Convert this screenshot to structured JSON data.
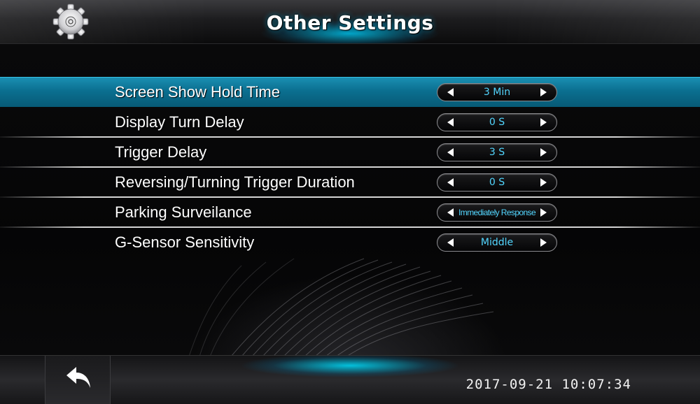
{
  "header": {
    "title": "Other Settings",
    "settings_icon": "gear-icon"
  },
  "settings": [
    {
      "label": "Screen Show Hold Time",
      "value": "3 Min",
      "selected": true
    },
    {
      "label": "Display Turn Delay",
      "value": "0 S",
      "selected": false
    },
    {
      "label": "Trigger Delay",
      "value": "3 S",
      "selected": false
    },
    {
      "label": "Reversing/Turning Trigger Duration",
      "value": "0 S",
      "selected": false
    },
    {
      "label": "Parking Surveilance",
      "value": "Immediately Response",
      "selected": false
    },
    {
      "label": "G-Sensor Sensitivity",
      "value": "Middle",
      "selected": false
    }
  ],
  "footer": {
    "back_icon": "back-arrow-icon",
    "datetime": "2017-09-21  10:07:34"
  },
  "colors": {
    "accent": "#0b6f90",
    "value_text": "#52d6ff",
    "glow": "#00c8f0"
  }
}
